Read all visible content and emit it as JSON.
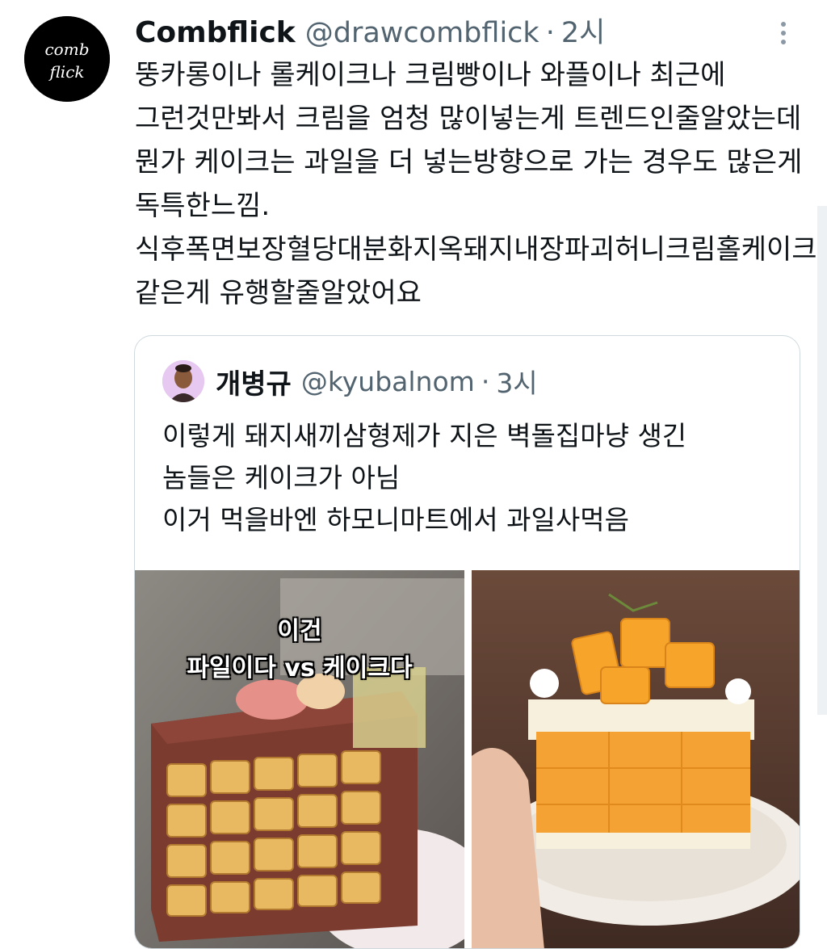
{
  "tweet": {
    "author_name": "Combflick",
    "author_handle": "@drawcombflick",
    "separator": "·",
    "time": "2시",
    "avatar_text": [
      "comb",
      "flick"
    ],
    "lines": [
      "뚱카롱이나 롤케이크나 크림빵이나 와플이나 최근에",
      "그런것만봐서 크림을 엄청 많이넣는게 트렌드인줄알았는데",
      "뭔가 케이크는 과일을 더 넣는방향으로 가는 경우도 많은게",
      "독특한느낌.",
      "식후폭면보장혈당대분화지옥돼지내장파괴허니크림홀케이크",
      "같은게 유행할줄알았어요"
    ]
  },
  "quote": {
    "author_name": "개병규",
    "author_handle": "@kyubalnom",
    "separator": "·",
    "time": "3시",
    "lines": [
      "이렇게 돼지새끼삼형제가 지은 벽돌집마냥 생긴",
      "놈들은 케이크가 아님",
      "이거 먹을바엔 하모니마트에서 과일사먹음"
    ],
    "image_left_caption": [
      "이건",
      "파일이다 vs 케이크다"
    ]
  },
  "icons": {
    "more": "more-vertical-icon"
  }
}
